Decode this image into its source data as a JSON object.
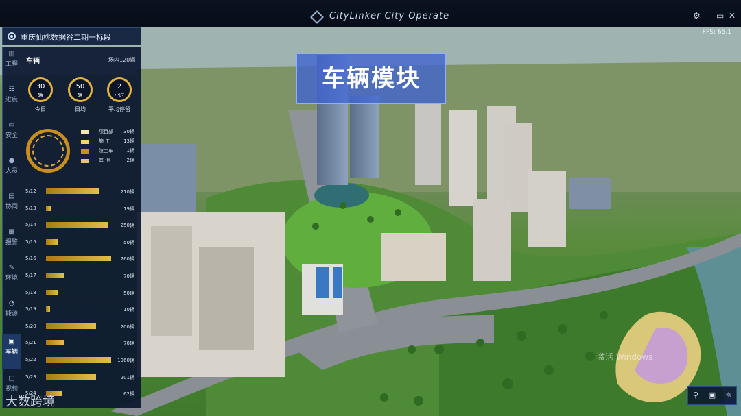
{
  "window": {
    "title": "CityLinker City Operate",
    "controls": [
      "⚙",
      "–",
      "▭",
      "✕"
    ]
  },
  "fps_label": "FPS: 65.1",
  "banner_text": "车辆模块",
  "project_name": "重庆仙桃数据谷二期一标段",
  "nav": [
    {
      "label": "工程",
      "icon": "building-icon"
    },
    {
      "label": "进度",
      "icon": "progress-icon"
    },
    {
      "label": "安全",
      "icon": "shield-icon"
    },
    {
      "label": "人员",
      "icon": "person-icon"
    },
    {
      "label": "协同",
      "icon": "document-icon"
    },
    {
      "label": "报警",
      "icon": "alarm-icon"
    },
    {
      "label": "环境",
      "icon": "leaf-icon"
    },
    {
      "label": "能源",
      "icon": "energy-icon"
    },
    {
      "label": "车辆",
      "icon": "vehicle-icon"
    },
    {
      "label": "视频",
      "icon": "video-icon"
    }
  ],
  "vehicle": {
    "title": "车辆",
    "subtitle": "场内120辆",
    "stats": [
      {
        "value": "30",
        "unit": "辆",
        "label": "今日"
      },
      {
        "value": "50",
        "unit": "辆",
        "label": "日均"
      },
      {
        "value": "2",
        "unit": "小时",
        "label": "平均停留"
      }
    ],
    "legend": [
      {
        "label": "项目部",
        "value": "30辆",
        "color": "#f3e7b0"
      },
      {
        "label": "施  工",
        "value": "13辆",
        "color": "#f1d46a"
      },
      {
        "label": "渣土车",
        "value": "1辆",
        "color": "#c98e1d"
      },
      {
        "label": "其  他",
        "value": "2辆",
        "color": "#e8c470"
      }
    ],
    "daily": [
      {
        "date": "5/12",
        "value_label": "210辆",
        "value": 210
      },
      {
        "date": "5/13",
        "value_label": "19辆",
        "value": 19
      },
      {
        "date": "5/14",
        "value_label": "250辆",
        "value": 250
      },
      {
        "date": "5/15",
        "value_label": "50辆",
        "value": 50
      },
      {
        "date": "5/16",
        "value_label": "260辆",
        "value": 260
      },
      {
        "date": "5/17",
        "value_label": "70辆",
        "value": 70
      },
      {
        "date": "5/18",
        "value_label": "50辆",
        "value": 50
      },
      {
        "date": "5/19",
        "value_label": "10辆",
        "value": 10
      },
      {
        "date": "5/20",
        "value_label": "200辆",
        "value": 200
      },
      {
        "date": "5/21",
        "value_label": "70辆",
        "value": 70
      },
      {
        "date": "5/22",
        "value_label": "1960辆",
        "value": 1960
      },
      {
        "date": "5/23",
        "value_label": "201辆",
        "value": 201
      },
      {
        "date": "5/24",
        "value_label": "62辆",
        "value": 62
      }
    ]
  },
  "toolbar": [
    "location-pin-icon",
    "camera-icon",
    "sun-icon"
  ],
  "watermark_text": "大数跨境",
  "windows_watermark": "激活 Windows"
}
